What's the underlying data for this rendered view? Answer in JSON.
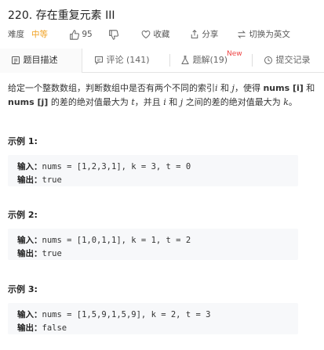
{
  "problem": {
    "title": "220. 存在重复元素 III",
    "difficulty_label": "难度",
    "difficulty": "中等",
    "likes": "95",
    "favorite": "收藏",
    "share": "分享",
    "switch_lang": "切换为英文"
  },
  "tabs": [
    {
      "label": "题目描述"
    },
    {
      "label": "评论 (141)"
    },
    {
      "label": "题解(19)",
      "badge": "New"
    },
    {
      "label": "提交记录"
    }
  ],
  "description": {
    "p1": "给定一个整数数组，判断数组中是否有两个不同的索引",
    "i": "i",
    "and1": " 和 ",
    "j": "j",
    "p2": "，使得 ",
    "nums_i": "nums [i]",
    "and2": " 和 ",
    "nums_j": "nums [j]",
    "p3": " 的差的绝对值最大为 ",
    "t": "t",
    "p4": "，并且 ",
    "i2": "i",
    "and3": " 和 ",
    "j2": "j",
    "p5": " 之间的差的绝对值最大为 ",
    "k": "k",
    "p6": "。"
  },
  "examples": [
    {
      "heading": "示例 1:",
      "input_label": "输入：",
      "input": "nums = [1,2,3,1], k = 3, t = 0",
      "output_label": "输出：",
      "output": "true"
    },
    {
      "heading": "示例 2:",
      "input_label": "输入：",
      "input": "nums = [1,0,1,1], k = 1, t = 2",
      "output_label": "输出：",
      "output": "true"
    },
    {
      "heading": "示例 3:",
      "input_label": "输入：",
      "input": "nums = [1,5,9,1,5,9], k = 2, t = 3",
      "output_label": "输出：",
      "output": "false"
    }
  ],
  "colors": {
    "difficulty": "#f0a020",
    "new_badge": "#e44444"
  }
}
